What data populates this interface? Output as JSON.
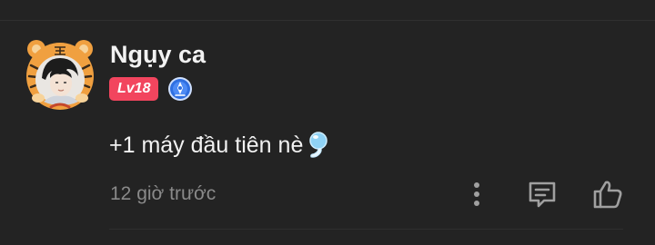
{
  "comment": {
    "username": "Ngụy ca",
    "level": "Lv18",
    "text": "+1 máy đầu tiên nè",
    "timestamp": "12 giờ trước"
  },
  "colors": {
    "background": "#232323",
    "level_badge": "#f2455e",
    "medal_blue": "#2f6fe0",
    "avatar_frame": "#f0a040"
  },
  "icons": {
    "more": "more-vertical-icon",
    "reply": "reply-comment-icon",
    "like": "thumbs-up-icon",
    "medal": "blue-medal-badge-icon",
    "emoji": "water-bubble-emoji-icon"
  }
}
